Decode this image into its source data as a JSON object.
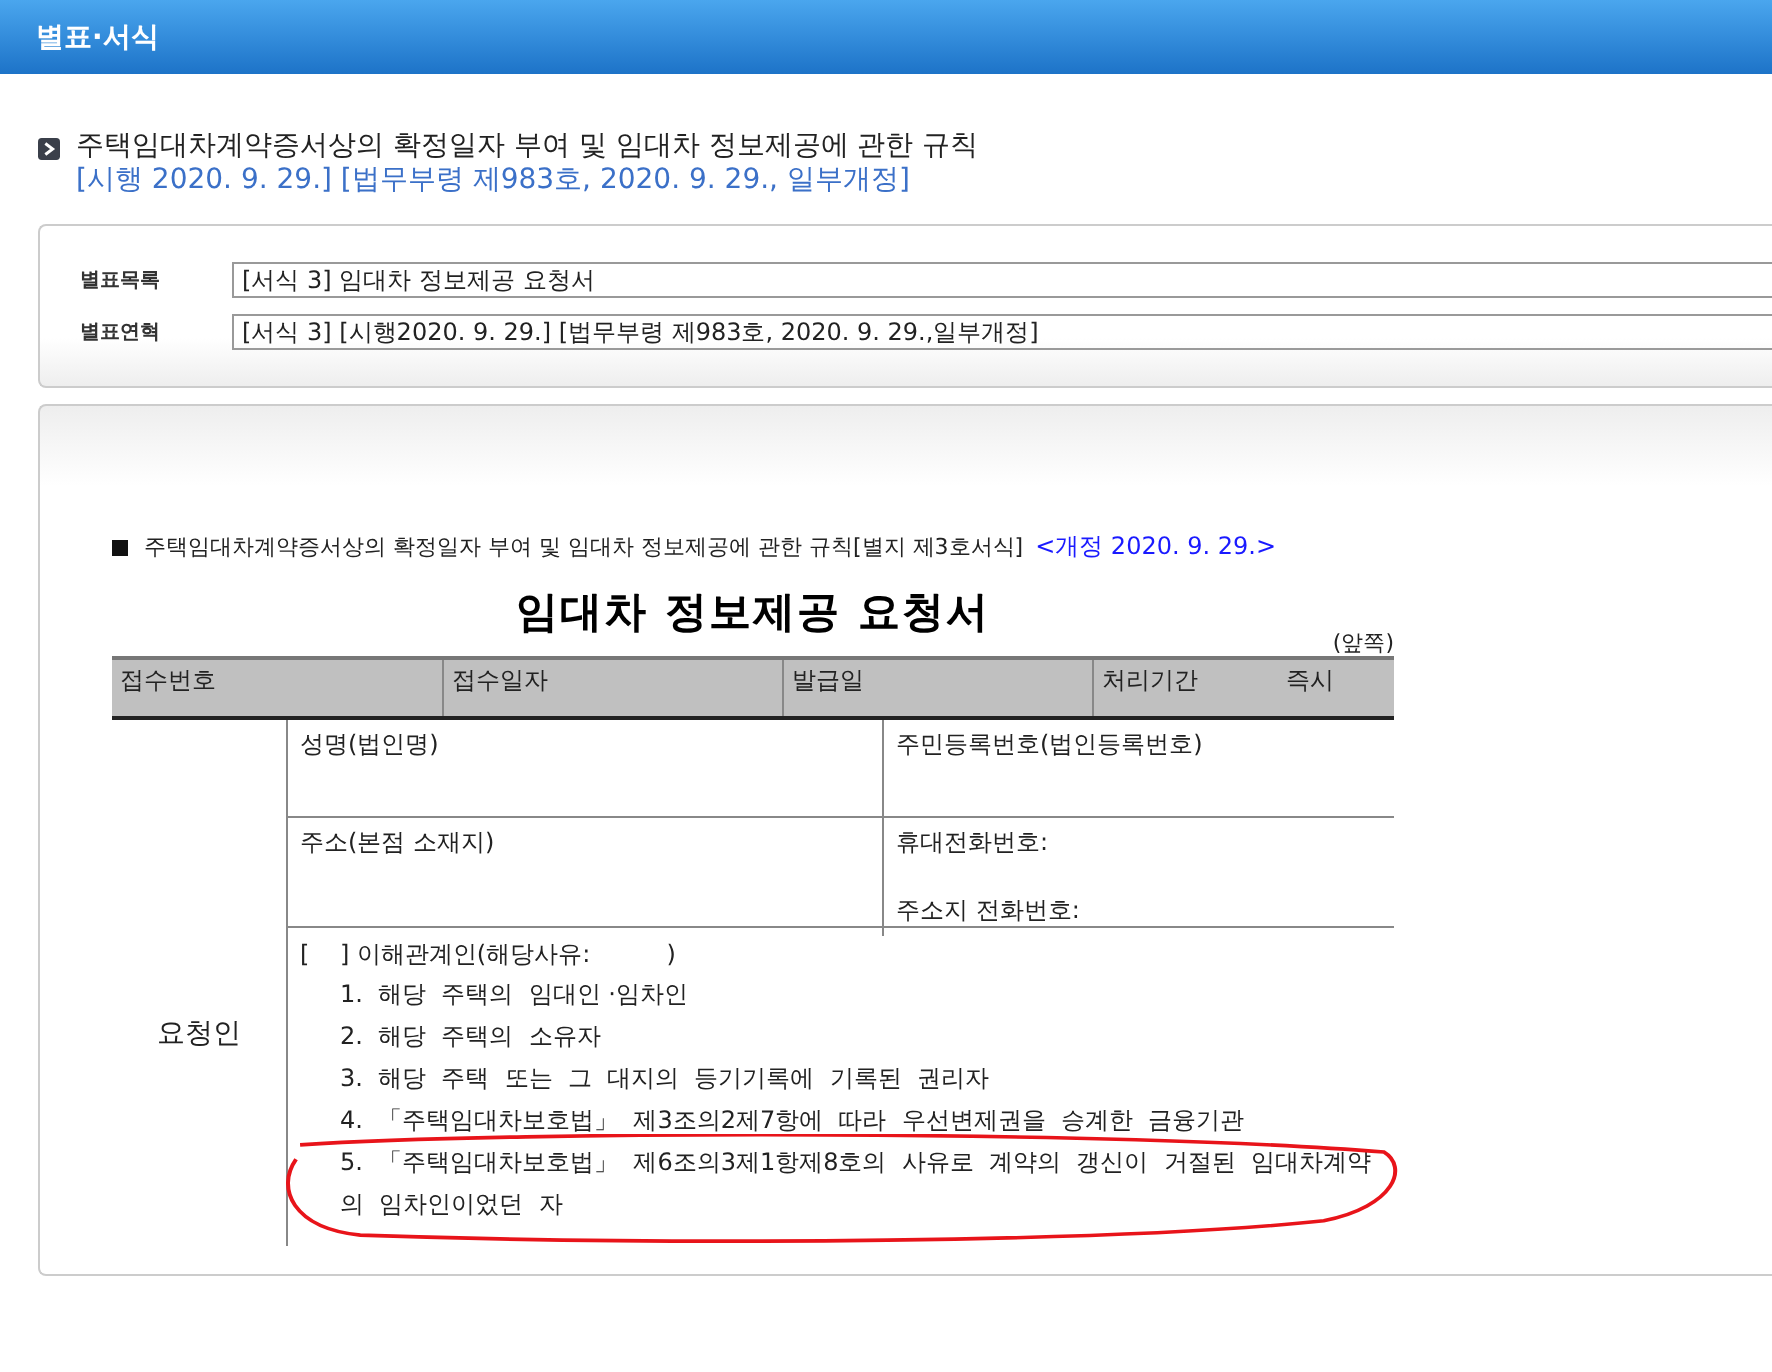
{
  "header": {
    "title": "별표·서식"
  },
  "law": {
    "title": "주택임대차계약증서상의 확정일자 부여 및 임대차 정보제공에 관한 규칙",
    "history": "[시행 2020. 9. 29.] [법무부령 제983호, 2020. 9. 29., 일부개정]"
  },
  "info_rows": [
    {
      "label": "별표목록",
      "value": "[서식 3] 임대차 정보제공 요청서"
    },
    {
      "label": "별표연혁",
      "value": "[서식 3] [시행2020. 9. 29.] [법무부령 제983호, 2020. 9. 29.,일부개정]"
    }
  ],
  "document": {
    "source": "주택임대차계약증서상의 확정일자 부여 및 임대차 정보제공에 관한 규칙[별지 제3호서식]",
    "amendment": "<개정 2020. 9. 29.>",
    "title": "임대차 정보제공 요청서",
    "page_side": "(앞쪽)",
    "header_cells": [
      {
        "label": "접수번호"
      },
      {
        "label": "접수일자"
      },
      {
        "label": "발급일"
      },
      {
        "label": "처리기간",
        "value": "즉시"
      }
    ],
    "requester_label": "요청인",
    "fields": [
      [
        "성명(법인명)",
        "주민등록번호(법인등록번호)"
      ],
      [
        "주소(본점  소재지)",
        "휴대전화번호:",
        "주소지  전화번호:"
      ]
    ],
    "checkbox_label": "[    ] 이해관계인(해당사유:          )",
    "items": [
      {
        "text": "1.  해당  주택의  임대인 ·임차인",
        "circled": false
      },
      {
        "text": "2.  해당  주택의  소유자",
        "circled": false
      },
      {
        "text": "3.  해당  주택  또는  그  대지의  등기기록에  기록된  권리자",
        "circled": false
      },
      {
        "text": "4.  「주택임대차보호법」  제3조의2제7항에  따라  우선변제권을  승계한  금융기관",
        "circled": false
      },
      {
        "text": "5.  「주택임대차보호법」  제6조의3제1항제8호의  사유로  계약의  갱신이  거절된  임대차계약의  임차인이었던  자",
        "circled": true
      }
    ]
  }
}
